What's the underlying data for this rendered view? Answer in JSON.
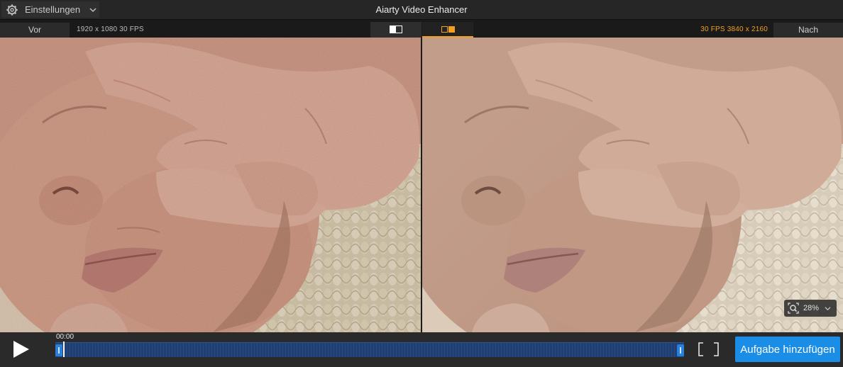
{
  "app": {
    "title": "Aiarty Video Enhancer"
  },
  "settings": {
    "label": "Einstellungen"
  },
  "compare": {
    "before_label": "Vor",
    "after_label": "Nach",
    "source_info": "1920 x 1080  30 FPS",
    "output_info": "30 FPS  3840 x 2160",
    "active_mode": "split"
  },
  "viewer": {
    "zoom": "28%"
  },
  "player": {
    "timecode": "00:00",
    "add_task_label": "Aufgabe hinzufügen"
  },
  "colors": {
    "accent": "#f0a020",
    "primary_button": "#1a8ee6",
    "timeline": "#1e3f73"
  },
  "icons": [
    "gear-icon",
    "chevron-down-icon",
    "single-view-icon",
    "split-view-icon",
    "zoom-icon",
    "play-icon",
    "bracket-in-icon",
    "bracket-out-icon"
  ]
}
